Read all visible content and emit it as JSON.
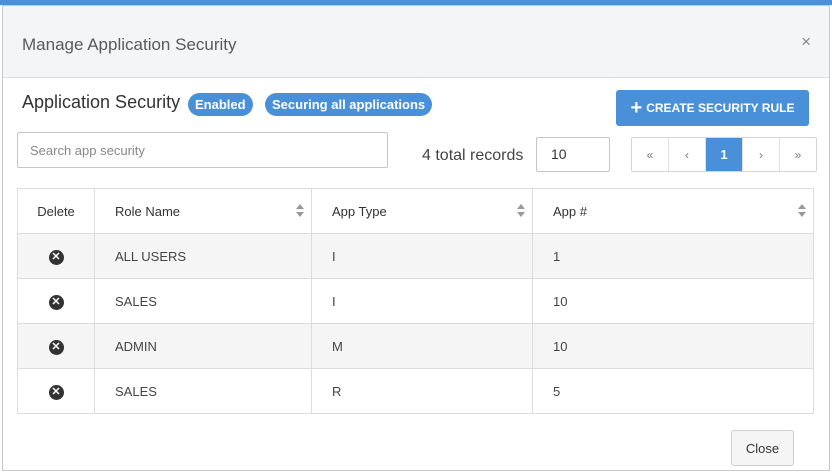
{
  "modal": {
    "title": "Manage Application Security",
    "close_glyph": "×"
  },
  "security": {
    "label": "Application Security",
    "status_badge": "Enabled",
    "scope_badge": "Securing all applications"
  },
  "toolbar": {
    "create_label": "CREATE SECURITY RULE",
    "create_icon": "plus-icon"
  },
  "search": {
    "placeholder": "Search app security",
    "value": ""
  },
  "records": {
    "text": "4 total records",
    "page_size": "10"
  },
  "pagination": {
    "first": "«",
    "prev": "‹",
    "current": "1",
    "next": "›",
    "last": "»"
  },
  "table": {
    "headers": {
      "delete": "Delete",
      "role_name": "Role Name",
      "app_type": "App Type",
      "app_num": "App #"
    },
    "rows": [
      {
        "role_name": "ALL USERS",
        "app_type": "I",
        "app_num": "1"
      },
      {
        "role_name": "SALES",
        "app_type": "I",
        "app_num": "10"
      },
      {
        "role_name": "ADMIN",
        "app_type": "M",
        "app_num": "10"
      },
      {
        "role_name": "SALES",
        "app_type": "R",
        "app_num": "5"
      }
    ],
    "delete_glyph": "✕"
  },
  "footer": {
    "close_label": "Close"
  },
  "colors": {
    "accent": "#4a90d9",
    "header_bg": "#f3f5f7",
    "row_alt": "#f5f5f5"
  }
}
